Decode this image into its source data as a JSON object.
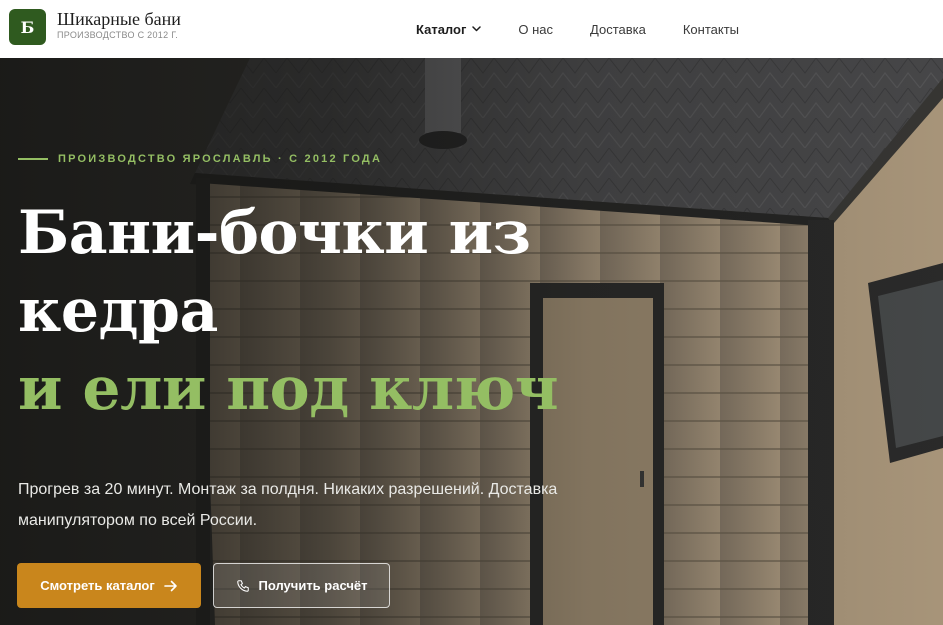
{
  "header": {
    "logo_letter": "Б",
    "brand_name": "Шикарные бани",
    "brand_sub": "ПРОИЗВОДСТВО С 2012 Г.",
    "nav": [
      {
        "label": "Каталог",
        "active": true,
        "has_dropdown": true
      },
      {
        "label": "О нас"
      },
      {
        "label": "Доставка"
      },
      {
        "label": "Контакты"
      }
    ]
  },
  "hero": {
    "eyebrow": "ПРОИЗВОДСТВО ЯРОСЛАВЛЬ · С 2012 ГОДА",
    "title_line1": "Бани-бочки из",
    "title_line2": "кедра",
    "title_accent": "и ели под ключ",
    "lead": "Прогрев за 20 минут. Монтаж за полдня. Никаких разрешений. Доставка манипулятором по всей России.",
    "primary_button": "Смотреть каталог",
    "secondary_button": "Получить расчёт"
  },
  "colors": {
    "brand_green": "#2f5a1f",
    "accent_green": "#94be63",
    "cta_orange": "#c9861c"
  },
  "icons": [
    "chevron-down-icon",
    "arrow-right-icon",
    "phone-icon"
  ]
}
